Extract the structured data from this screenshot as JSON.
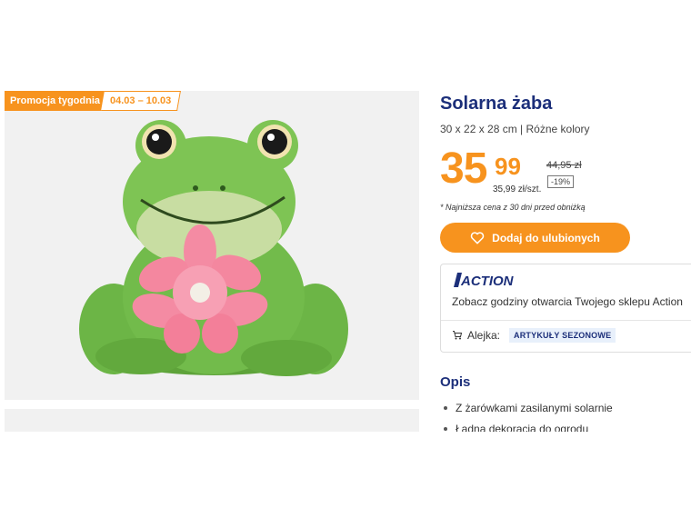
{
  "promo": {
    "label": "Promocja tygodnia",
    "dates": "04.03 – 10.03"
  },
  "product": {
    "title": "Solarna żaba",
    "subtitle": "30 x 22 x 28 cm | Różne kolory",
    "image_alt": "frog-figurine"
  },
  "price": {
    "integer": "35",
    "decimal": "99",
    "unit_price": "35,99 zł/szt.",
    "old_price": "44,95 zł",
    "discount": "-19%",
    "lowest_note": "* Najniższa cena z 30 dni przed obniżką"
  },
  "favorite_button": {
    "label": "Dodaj do ulubionych",
    "icon": "heart-icon"
  },
  "store": {
    "logo_text": "ACTION",
    "hours_link": "Zobacz godziny otwarcia Twojego sklepu Action",
    "aisle_label": "Alejka:",
    "aisle_value": "ARTYKUŁY SEZONOWE",
    "aisle_icon": "cart-icon"
  },
  "description": {
    "title": "Opis",
    "bullets": [
      "Z żarówkami zasilanymi solarnie",
      "Ładna dekoracja do ogrodu"
    ]
  },
  "colors": {
    "accent": "#f7931e",
    "brand_blue": "#1c2f7a"
  }
}
